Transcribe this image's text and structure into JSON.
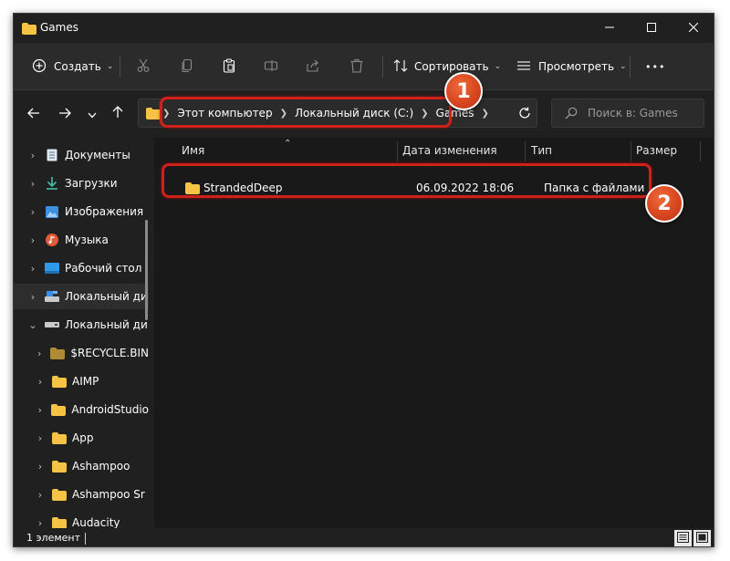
{
  "window": {
    "title": "Games"
  },
  "toolbar": {
    "create_label": "Создать",
    "sort_label": "Сортировать",
    "view_label": "Просмотреть",
    "more_label": "•••"
  },
  "address": {
    "crumbs": [
      "Этот компьютер",
      "Локальный диск (C:)",
      "Games"
    ],
    "search_placeholder": "Поиск в: Games"
  },
  "sidebar": {
    "items": [
      {
        "label": "Документы",
        "icon": "documents-icon"
      },
      {
        "label": "Загрузки",
        "icon": "downloads-icon"
      },
      {
        "label": "Изображения",
        "icon": "pictures-icon"
      },
      {
        "label": "Музыка",
        "icon": "music-icon"
      },
      {
        "label": "Рабочий стол",
        "icon": "desktop-icon"
      },
      {
        "label": "Локальный ди",
        "icon": "drive-icon"
      },
      {
        "label": "Локальный ди",
        "icon": "drive-icon"
      },
      {
        "label": "$RECYCLE.BIN",
        "icon": "folder-icon"
      },
      {
        "label": "AIMP",
        "icon": "folder-icon"
      },
      {
        "label": "AndroidStudio",
        "icon": "folder-icon"
      },
      {
        "label": "App",
        "icon": "folder-icon"
      },
      {
        "label": "Ashampoo",
        "icon": "folder-icon"
      },
      {
        "label": "Ashampoo Sr",
        "icon": "folder-icon"
      },
      {
        "label": "Audacity",
        "icon": "folder-icon"
      }
    ]
  },
  "columns": [
    "Имя",
    "Дата изменения",
    "Тип",
    "Размер"
  ],
  "files": [
    {
      "name": "StrandedDeep",
      "date": "06.09.2022 18:06",
      "type": "Папка с файлами",
      "size": ""
    }
  ],
  "status": {
    "count": "1 элемент"
  },
  "annotations": {
    "badge1": "1",
    "badge2": "2",
    "color": "#d0201a"
  },
  "colors": {
    "folder": "#f6c344",
    "background": "#202020",
    "content": "#191919"
  }
}
